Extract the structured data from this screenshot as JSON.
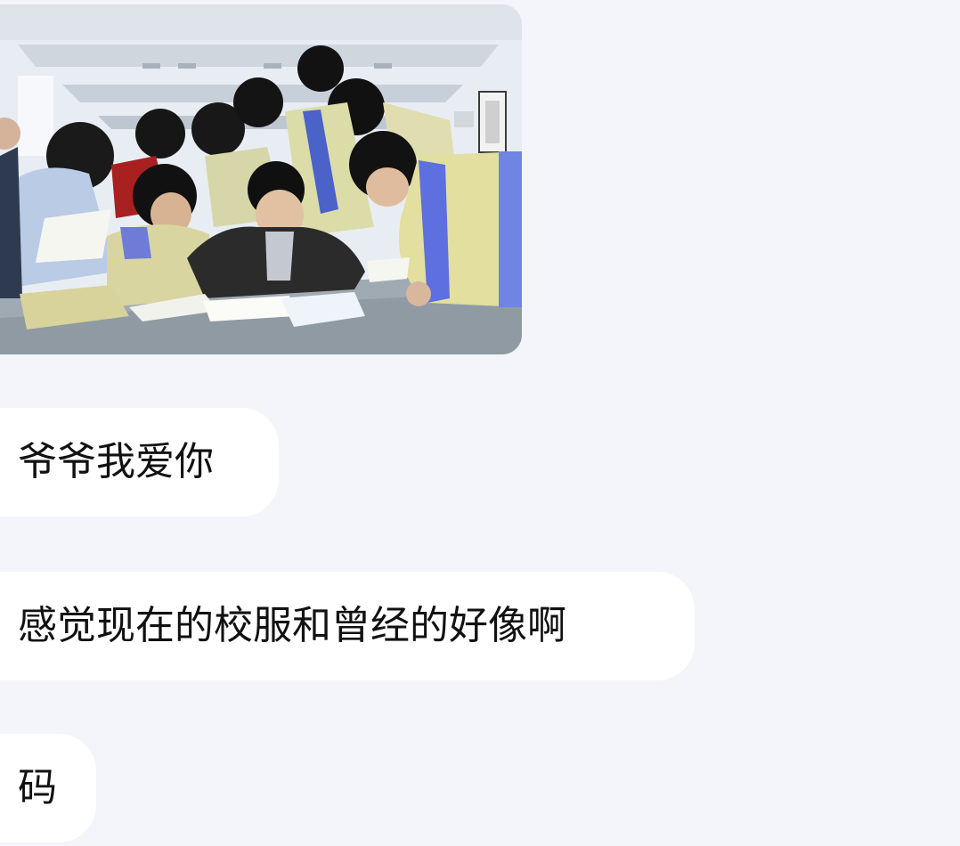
{
  "chat": {
    "photo": {
      "icon": "classroom-photo",
      "description_visible": false
    },
    "messages": [
      {
        "text": "爷爷我爱你"
      },
      {
        "text": "感觉现在的校服和曾经的好像啊"
      },
      {
        "text": "码"
      }
    ]
  },
  "colors": {
    "background": "#f3f5fa",
    "bubble": "#ffffff",
    "text": "#111111"
  }
}
